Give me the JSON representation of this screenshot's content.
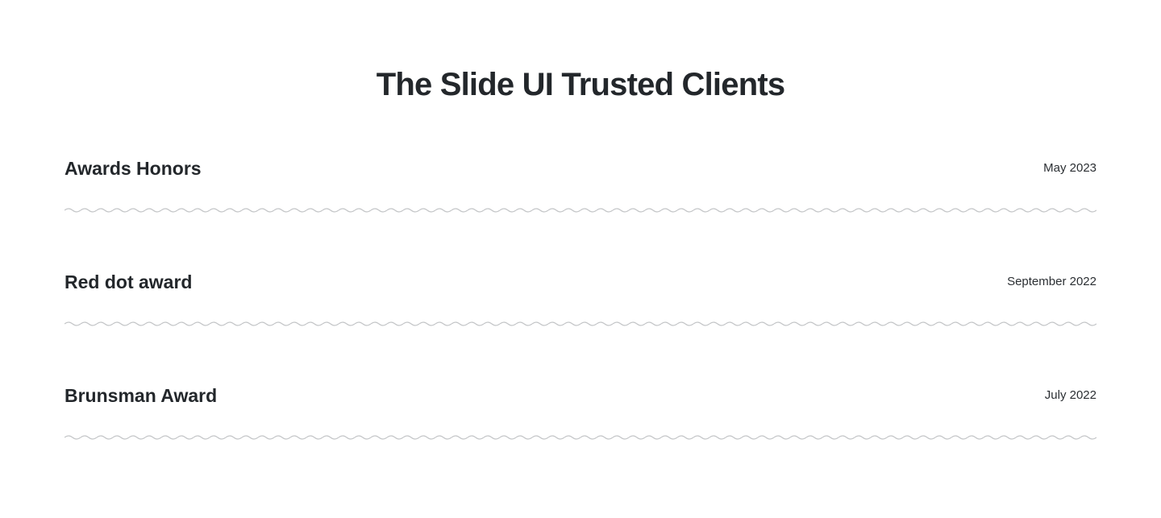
{
  "header": {
    "title": "The Slide UI Trusted Clients"
  },
  "items": [
    {
      "title": "Awards Honors",
      "date": "May 2023"
    },
    {
      "title": "Red dot award",
      "date": "September 2022"
    },
    {
      "title": "Brunsman Award",
      "date": "July 2022"
    }
  ],
  "colors": {
    "text": "#23272b",
    "wave": "#c4c6c8"
  }
}
